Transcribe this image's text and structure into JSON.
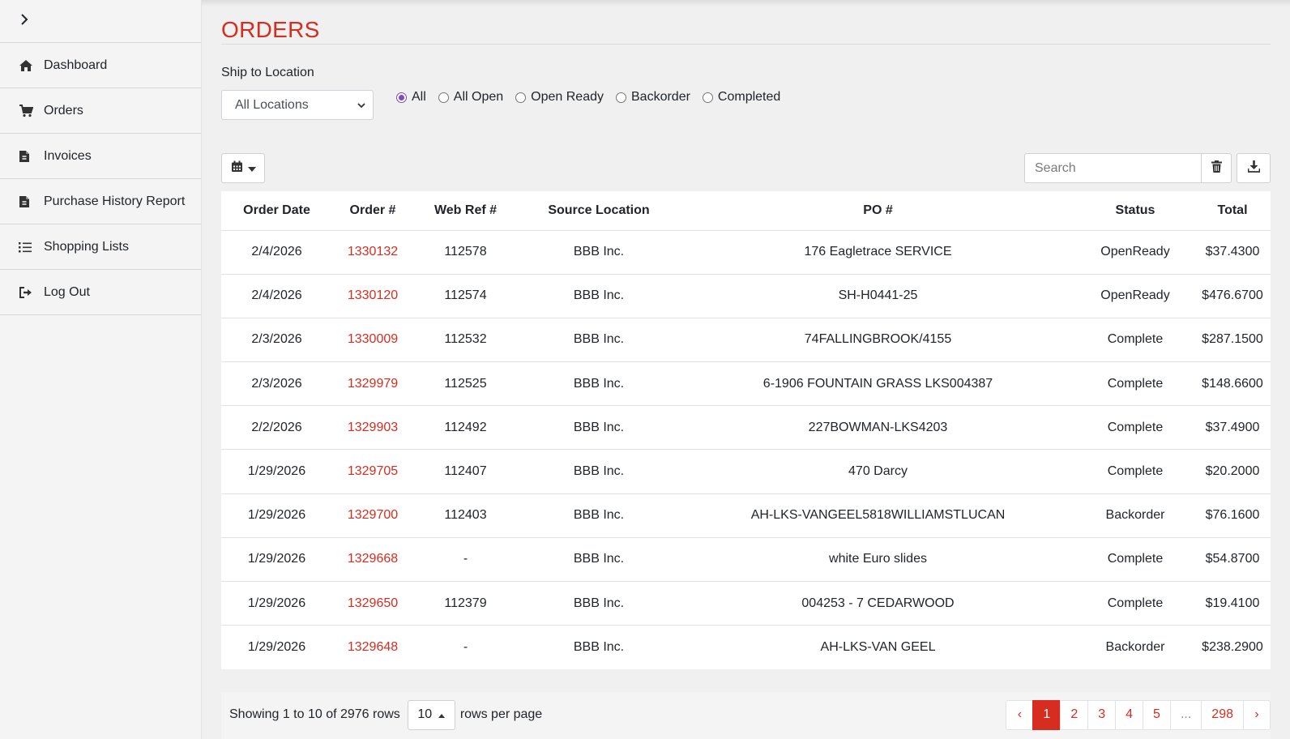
{
  "sidebar": {
    "items": [
      {
        "label": "Dashboard",
        "icon": "home-icon"
      },
      {
        "label": "Orders",
        "icon": "cart-icon"
      },
      {
        "label": "Invoices",
        "icon": "invoice-icon"
      },
      {
        "label": "Purchase History Report",
        "icon": "invoice-icon"
      },
      {
        "label": "Shopping Lists",
        "icon": "list-icon"
      },
      {
        "label": "Log Out",
        "icon": "logout-icon"
      }
    ]
  },
  "page": {
    "title": "ORDERS"
  },
  "filters": {
    "location_label": "Ship to Location",
    "location_value": "All Locations",
    "status_options": [
      "All",
      "All Open",
      "Open Ready",
      "Backorder",
      "Completed"
    ],
    "selected_status": "All"
  },
  "search": {
    "placeholder": "Search"
  },
  "table": {
    "columns": [
      "Order Date",
      "Order #",
      "Web Ref #",
      "Source Location",
      "PO #",
      "Status",
      "Total"
    ],
    "rows": [
      [
        "2/4/2026",
        "1330132",
        "112578",
        "BBB Inc.",
        "176 Eagletrace SERVICE",
        "OpenReady",
        "$37.4300"
      ],
      [
        "2/4/2026",
        "1330120",
        "112574",
        "BBB Inc.",
        "SH-H0441-25",
        "OpenReady",
        "$476.6700"
      ],
      [
        "2/3/2026",
        "1330009",
        "112532",
        "BBB Inc.",
        "74FALLINGBROOK/4155",
        "Complete",
        "$287.1500"
      ],
      [
        "2/3/2026",
        "1329979",
        "112525",
        "BBB Inc.",
        "6-1906 FOUNTAIN GRASS LKS004387",
        "Complete",
        "$148.6600"
      ],
      [
        "2/2/2026",
        "1329903",
        "112492",
        "BBB Inc.",
        "227BOWMAN-LKS4203",
        "Complete",
        "$37.4900"
      ],
      [
        "1/29/2026",
        "1329705",
        "112407",
        "BBB Inc.",
        "470 Darcy",
        "Complete",
        "$20.2000"
      ],
      [
        "1/29/2026",
        "1329700",
        "112403",
        "BBB Inc.",
        "AH-LKS-VANGEEL5818WILLIAMSTLUCAN",
        "Backorder",
        "$76.1600"
      ],
      [
        "1/29/2026",
        "1329668",
        "-",
        "BBB Inc.",
        "white Euro slides",
        "Complete",
        "$54.8700"
      ],
      [
        "1/29/2026",
        "1329650",
        "112379",
        "BBB Inc.",
        "004253 - 7 CEDARWOOD",
        "Complete",
        "$19.4100"
      ],
      [
        "1/29/2026",
        "1329648",
        "-",
        "BBB Inc.",
        "AH-LKS-VAN GEEL",
        "Backorder",
        "$238.2900"
      ]
    ]
  },
  "footer": {
    "showing_text": "Showing 1 to 10 of 2976 rows",
    "rows_per_page_value": "10",
    "rows_per_page_label": "rows per page",
    "pages": [
      "‹",
      "1",
      "2",
      "3",
      "4",
      "5",
      "...",
      "298",
      "›"
    ],
    "active_page": "1"
  },
  "colors": {
    "accent": "#d62d20",
    "radio": "#7b4bc4"
  }
}
